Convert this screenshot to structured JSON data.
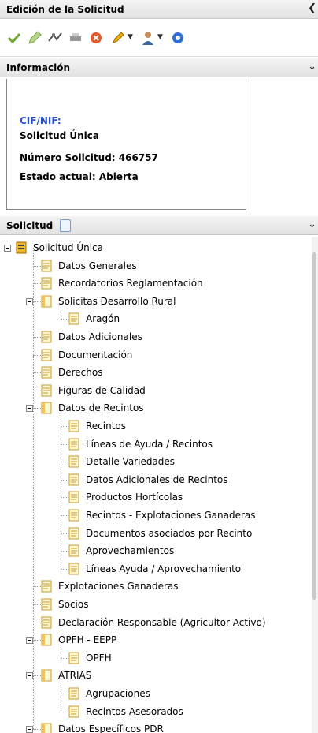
{
  "header": {
    "title": "Edición de la Solicitud"
  },
  "toolbar": {
    "icons": [
      "check-icon",
      "edit-icon",
      "links-icon",
      "print-icon",
      "delete-icon",
      "pencil-icon",
      "user-icon",
      "info-icon"
    ]
  },
  "info": {
    "title": "Información",
    "cif_label": "CIF/NIF:",
    "line1": "Solicitud Única",
    "line2": "Número Solicitud: 466757",
    "line3": "Estado actual: Abierta"
  },
  "solicitud": {
    "title": "Solicitud"
  },
  "tree": [
    {
      "label": "Solicitud Única",
      "level": 0,
      "type": "root"
    },
    {
      "label": "Datos Generales",
      "level": 1,
      "type": "doc"
    },
    {
      "label": "Recordatorios Reglamentación",
      "level": 1,
      "type": "doc"
    },
    {
      "label": "Solicitas Desarrollo Rural",
      "level": 1,
      "type": "folder"
    },
    {
      "label": "Aragón",
      "level": 2,
      "type": "doc"
    },
    {
      "label": "Datos Adicionales",
      "level": 1,
      "type": "doc"
    },
    {
      "label": "Documentación",
      "level": 1,
      "type": "doc"
    },
    {
      "label": "Derechos",
      "level": 1,
      "type": "doc"
    },
    {
      "label": "Figuras de Calidad",
      "level": 1,
      "type": "doc"
    },
    {
      "label": "Datos de Recintos",
      "level": 1,
      "type": "folder"
    },
    {
      "label": "Recintos",
      "level": 2,
      "type": "doc"
    },
    {
      "label": "Líneas de Ayuda / Recintos",
      "level": 2,
      "type": "doc"
    },
    {
      "label": "Detalle Variedades",
      "level": 2,
      "type": "doc"
    },
    {
      "label": "Datos Adicionales de Recintos",
      "level": 2,
      "type": "doc"
    },
    {
      "label": "Productos Hortícolas",
      "level": 2,
      "type": "doc"
    },
    {
      "label": "Recintos - Explotaciones Ganaderas",
      "level": 2,
      "type": "doc"
    },
    {
      "label": "Documentos asociados por Recinto",
      "level": 2,
      "type": "doc"
    },
    {
      "label": "Aprovechamientos",
      "level": 2,
      "type": "doc"
    },
    {
      "label": "Líneas Ayuda / Aprovechamiento",
      "level": 2,
      "type": "doc"
    },
    {
      "label": "Explotaciones Ganaderas",
      "level": 1,
      "type": "doc"
    },
    {
      "label": "Socios",
      "level": 1,
      "type": "doc"
    },
    {
      "label": "Declaración Responsable (Agricultor Activo)",
      "level": 1,
      "type": "doc"
    },
    {
      "label": "OPFH - EEPP",
      "level": 1,
      "type": "folder"
    },
    {
      "label": "OPFH",
      "level": 2,
      "type": "doc"
    },
    {
      "label": "ATRIAS",
      "level": 1,
      "type": "folder"
    },
    {
      "label": "Agrupaciones",
      "level": 2,
      "type": "doc"
    },
    {
      "label": "Recintos Asesorados",
      "level": 2,
      "type": "doc"
    },
    {
      "label": "Datos Específicos PDR",
      "level": 1,
      "type": "folder"
    }
  ]
}
